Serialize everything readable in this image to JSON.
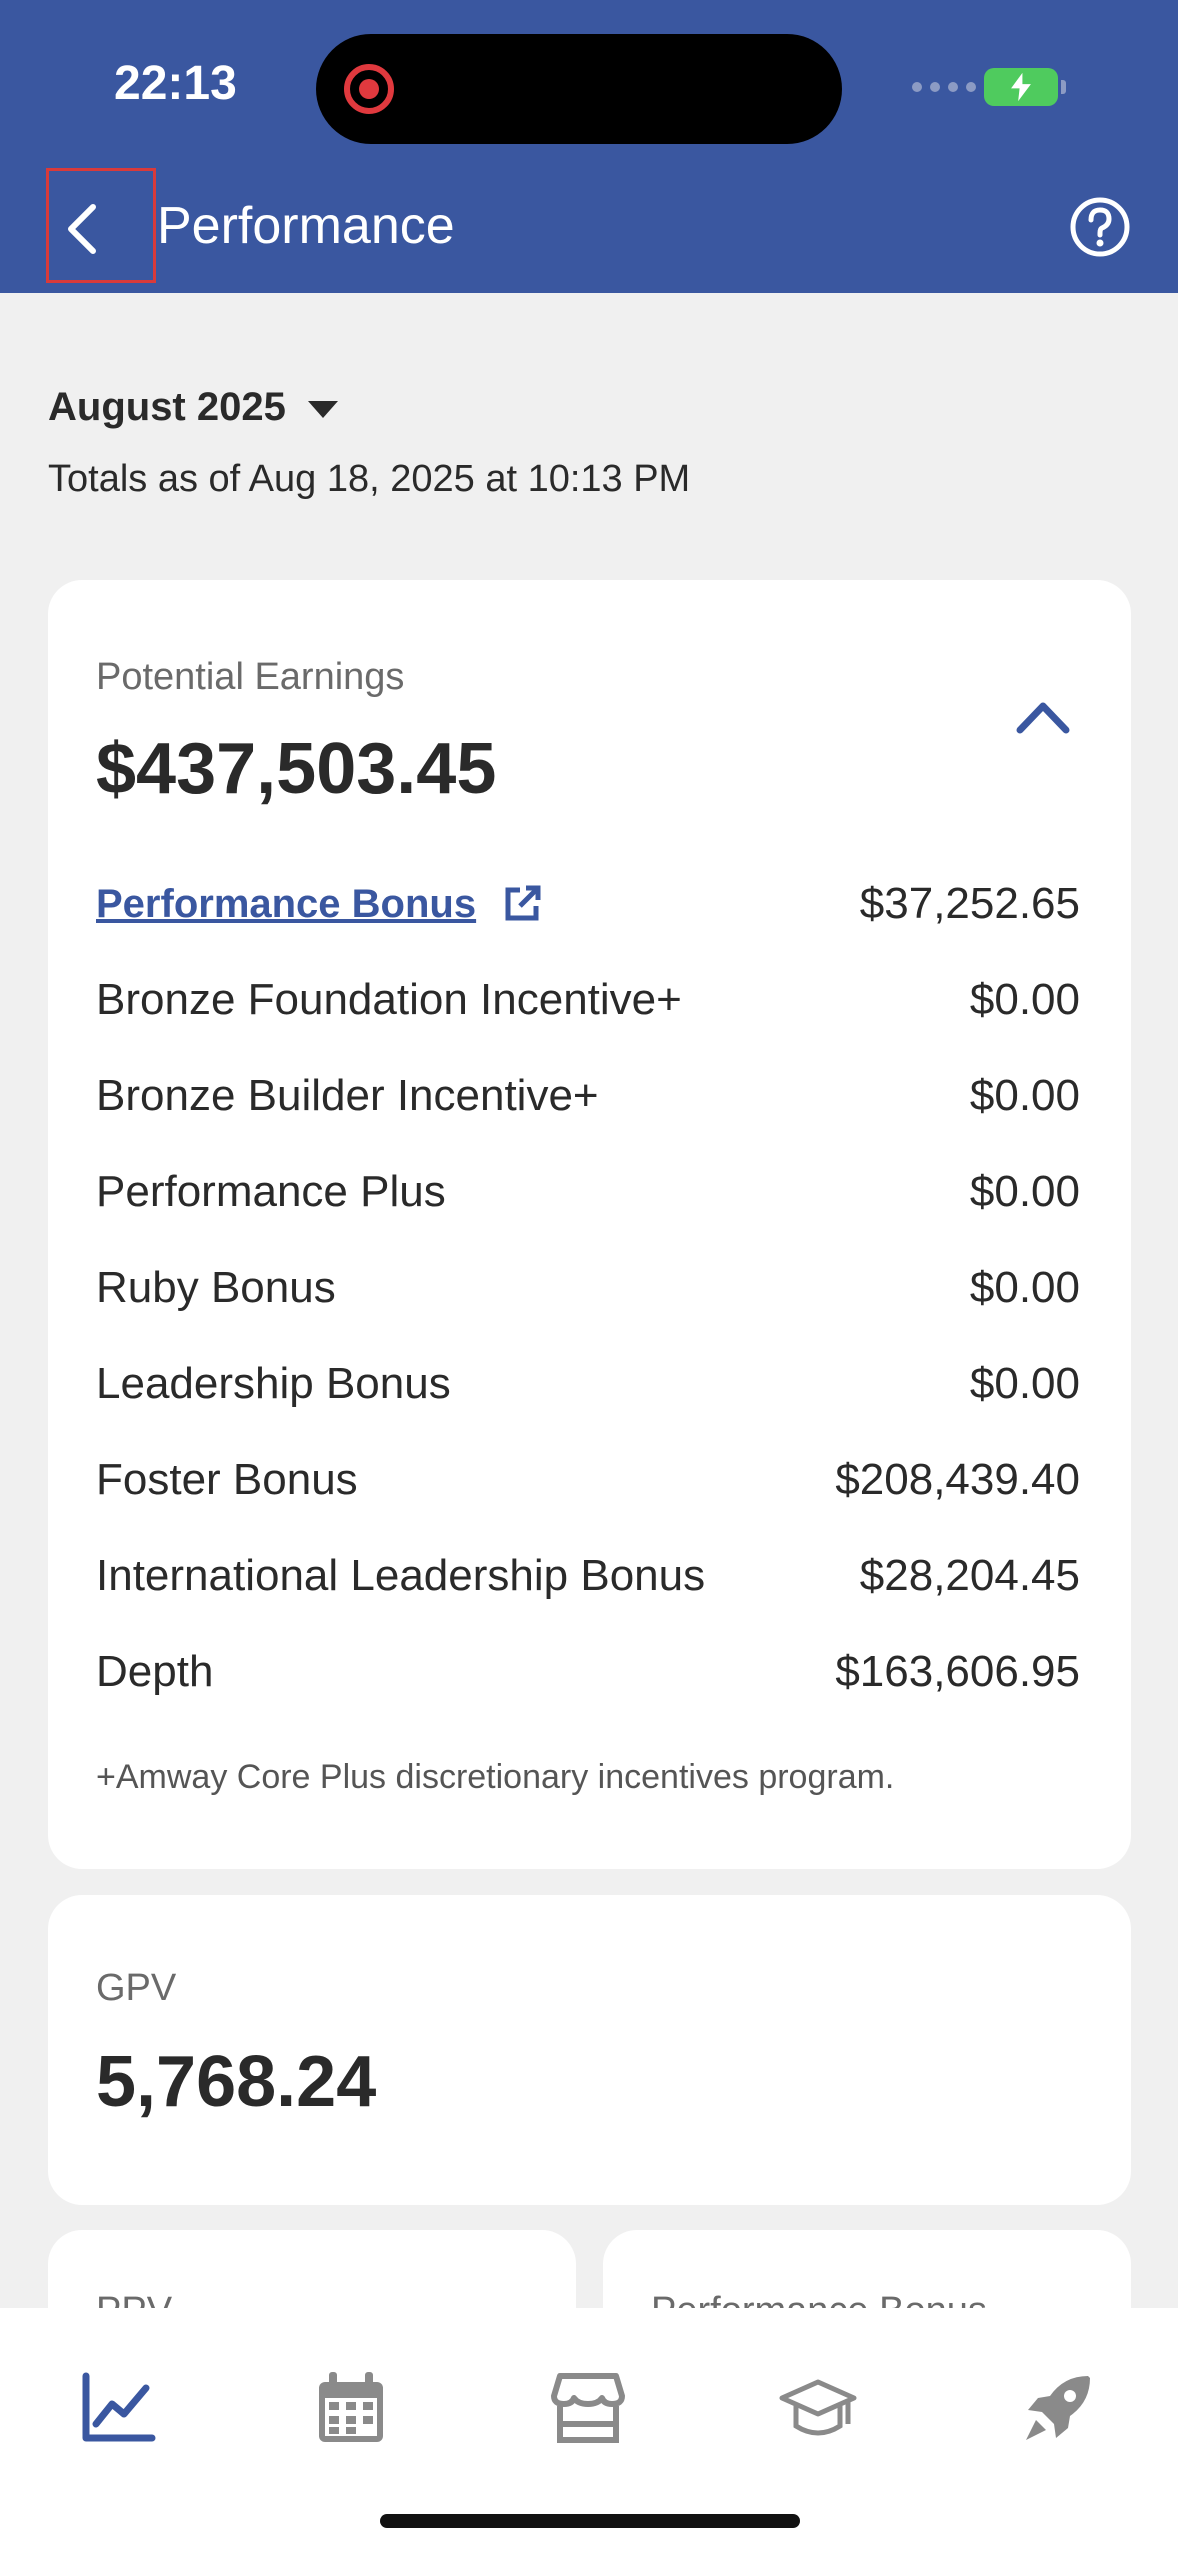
{
  "status_bar": {
    "time": "22:13"
  },
  "header": {
    "title": "Performance"
  },
  "period": {
    "month": "August 2025",
    "totals_as_of": "Totals as of Aug 18, 2025 at 10:13 PM"
  },
  "earnings": {
    "label": "Potential Earnings",
    "total": "$437,503.45",
    "performance_bonus_label": "Performance Bonus",
    "performance_bonus_value": "$37,252.65",
    "rows": [
      {
        "label": "Bronze Foundation Incentive+",
        "value": "$0.00"
      },
      {
        "label": "Bronze Builder Incentive+",
        "value": "$0.00"
      },
      {
        "label": "Performance Plus",
        "value": "$0.00"
      },
      {
        "label": "Ruby Bonus",
        "value": "$0.00"
      },
      {
        "label": "Leadership Bonus",
        "value": "$0.00"
      },
      {
        "label": "Foster Bonus",
        "value": "$208,439.40"
      },
      {
        "label": "International Leadership Bonus",
        "value": "$28,204.45"
      },
      {
        "label": "Depth",
        "value": "$163,606.95"
      }
    ],
    "footnote": "+Amway Core Plus discretionary incentives program."
  },
  "gpv": {
    "label": "GPV",
    "value": "5,768.24"
  },
  "small_cards": [
    {
      "label": "PPV"
    },
    {
      "label": "Performance Bonus"
    }
  ],
  "tabs": [
    {
      "icon": "chart-line-icon",
      "active": true
    },
    {
      "icon": "calendar-icon",
      "active": false
    },
    {
      "icon": "store-icon",
      "active": false
    },
    {
      "icon": "graduation-cap-icon",
      "active": false
    },
    {
      "icon": "rocket-icon",
      "active": false
    }
  ],
  "colors": {
    "primary": "#3a57a0",
    "background": "#f0f0f0",
    "card": "#ffffff",
    "highlight": "#d93a3a"
  }
}
